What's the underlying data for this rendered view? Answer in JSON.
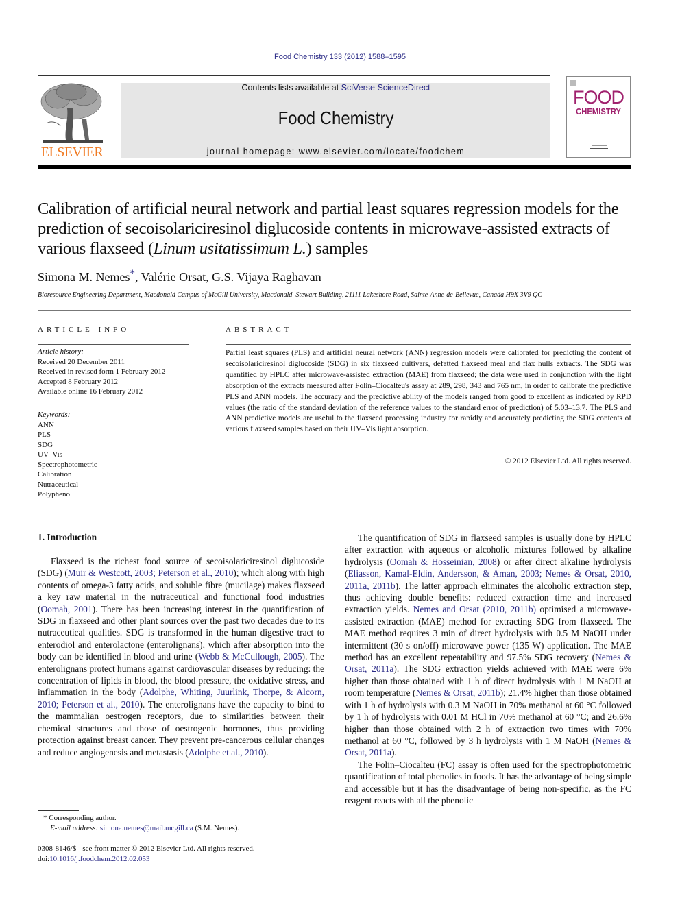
{
  "header": {
    "citation": "Food Chemistry 133 (2012) 1588–1595",
    "contents_prefix": "Contents lists available at ",
    "contents_link": "SciVerse ScienceDirect",
    "journal_title": "Food Chemistry",
    "homepage": "journal homepage: www.elsevier.com/locate/foodchem",
    "publisher": "ELSEVIER",
    "cover_line1": "FOOD",
    "cover_line2": "CHEMISTRY"
  },
  "article": {
    "title_part1": "Calibration of artificial neural network and partial least squares regression models for the prediction of secoisolariciresinol diglucoside contents in microwave-assisted extracts of various flaxseed (",
    "title_italic": "Linum usitatissimum L.",
    "title_part2": ") samples",
    "author1": "Simona M. Nemes",
    "author_marker": "*",
    "authors_rest": ", Valérie Orsat, G.S. Vijaya Raghavan",
    "affiliation": "Bioresource Engineering Department, Macdonald Campus of McGill University, Macdonald–Stewart Building, 21111 Lakeshore Road, Sainte-Anne-de-Bellevue, Canada H9X 3V9 QC"
  },
  "article_info": {
    "heading": "ARTICLE INFO",
    "history_label": "Article history:",
    "history": [
      "Received 20 December 2011",
      "Received in revised form 1 February 2012",
      "Accepted 8 February 2012",
      "Available online 16 February 2012"
    ],
    "keywords_label": "Keywords:",
    "keywords": [
      "ANN",
      "PLS",
      "SDG",
      "UV–Vis",
      "Spectrophotometric",
      "Calibration",
      "Nutraceutical",
      "Polyphenol"
    ]
  },
  "abstract": {
    "heading": "ABSTRACT",
    "text": "Partial least squares (PLS) and artificial neural network (ANN) regression models were calibrated for predicting the content of secoisolariciresinol diglucoside (SDG) in six flaxseed cultivars, defatted flaxseed meal and flax hulls extracts. The SDG was quantified by HPLC after microwave-assisted extraction (MAE) from flaxseed; the data were used in conjunction with the light absorption of the extracts measured after Folin–Ciocalteu's assay at 289, 298, 343 and 765 nm, in order to calibrate the predictive PLS and ANN models. The accuracy and the predictive ability of the models ranged from good to excellent as indicated by RPD values (the ratio of the standard deviation of the reference values to the standard error of prediction) of 5.03–13.7. The PLS and ANN predictive models are useful to the flaxseed processing industry for rapidly and accurately predicting the SDG contents of various flaxseed samples based on their UV–Vis light absorption.",
    "copyright": "© 2012 Elsevier Ltd. All rights reserved."
  },
  "introduction": {
    "heading": "1. Introduction",
    "p1": [
      {
        "t": "Flaxseed is the richest food source of secoisolariciresinol diglucoside (SDG) ("
      },
      {
        "l": "Muir & Westcott, 2003; Peterson et al., 2010"
      },
      {
        "t": "); which along with high contents of omega-3 fatty acids, and soluble fibre (mucilage) makes flaxseed a key raw material in the nutraceutical and functional food industries ("
      },
      {
        "l": "Oomah, 2001"
      },
      {
        "t": "). There has been increasing interest in the quantification of SDG in flaxseed and other plant sources over the past two decades due to its nutraceutical qualities. SDG is transformed in the human digestive tract to enterodiol and enterolactone (enterolignans), which after absorption into the body can be identified in blood and urine ("
      },
      {
        "l": "Webb & McCullough, 2005"
      },
      {
        "t": "). The enterolignans protect humans against cardiovascular diseases by reducing: the concentration of lipids in blood, the blood pressure, the oxidative stress, and inflammation in the body ("
      },
      {
        "l": "Adolphe, Whiting, Juurlink, Thorpe, & Alcorn, 2010; Peterson et al., 2010"
      },
      {
        "t": "). The enterolignans have the capacity to bind to the mammalian oestrogen receptors, due to similarities between their chemical structures and those of oestrogenic hormones, thus providing protection against breast cancer. They prevent pre-cancerous cellular changes and reduce angiogenesis and metastasis ("
      },
      {
        "l": "Adolphe et al., 2010"
      },
      {
        "t": ")."
      }
    ],
    "p2": [
      {
        "t": "The quantification of SDG in flaxseed samples is usually done by HPLC after extraction with aqueous or alcoholic mixtures followed by alkaline hydrolysis ("
      },
      {
        "l": "Oomah & Hosseinian, 2008"
      },
      {
        "t": ") or after direct alkaline hydrolysis ("
      },
      {
        "l": "Eliasson, Kamal-Eldin, Andersson, & Aman, 2003; Nemes & Orsat, 2010, 2011a, 2011b"
      },
      {
        "t": "). The latter approach eliminates the alcoholic extraction step, thus achieving double benefits: reduced extraction time and increased extraction yields. "
      },
      {
        "l": "Nemes and Orsat (2010, 2011b)"
      },
      {
        "t": " optimised a microwave-assisted extraction (MAE) method for extracting SDG from flaxseed. The MAE method requires 3 min of direct hydrolysis with 0.5 M NaOH under intermittent (30 s on/off) microwave power (135 W) application. The MAE method has an excellent repeatability and 97.5% SDG recovery ("
      },
      {
        "l": "Nemes & Orsat, 2011a"
      },
      {
        "t": "). The SDG extraction yields achieved with MAE were 6% higher than those obtained with 1 h of direct hydrolysis with 1 M NaOH at room temperature ("
      },
      {
        "l": "Nemes & Orsat, 2011b"
      },
      {
        "t": "); 21.4% higher than those obtained with 1 h of hydrolysis with 0.3 M NaOH in 70% methanol at 60 °C followed by 1 h of hydrolysis with 0.01 M HCl in 70% methanol at 60 °C; and 26.6% higher than those obtained with 2 h of extraction two times with 70% methanol at 60 °C, followed by 3 h hydrolysis with 1 M NaOH ("
      },
      {
        "l": "Nemes & Orsat, 2011a"
      },
      {
        "t": ")."
      }
    ],
    "p3": [
      {
        "t": "The Folin–Ciocalteu (FC) assay is often used for the spectrophotometric quantification of total phenolics in foods. It has the advantage of being simple and accessible but it has the disadvantage of being non-specific, as the FC reagent reacts with all the phenolic"
      }
    ]
  },
  "footnote": {
    "marker": "*",
    "corresponding": "Corresponding author.",
    "email_label": "E-mail address:",
    "email": "simona.nemes@mail.mcgill.ca",
    "email_suffix": " (S.M. Nemes)."
  },
  "front_matter": {
    "issn_line": "0308-8146/$ - see front matter © 2012 Elsevier Ltd. All rights reserved.",
    "doi_prefix": "doi:",
    "doi": "10.1016/j.foodchem.2012.02.053"
  },
  "colors": {
    "link": "#2a2a86",
    "elsevier_orange": "#f07a22",
    "cover_magenta": "#a0226e",
    "masthead_bg": "#e6e6e6"
  }
}
